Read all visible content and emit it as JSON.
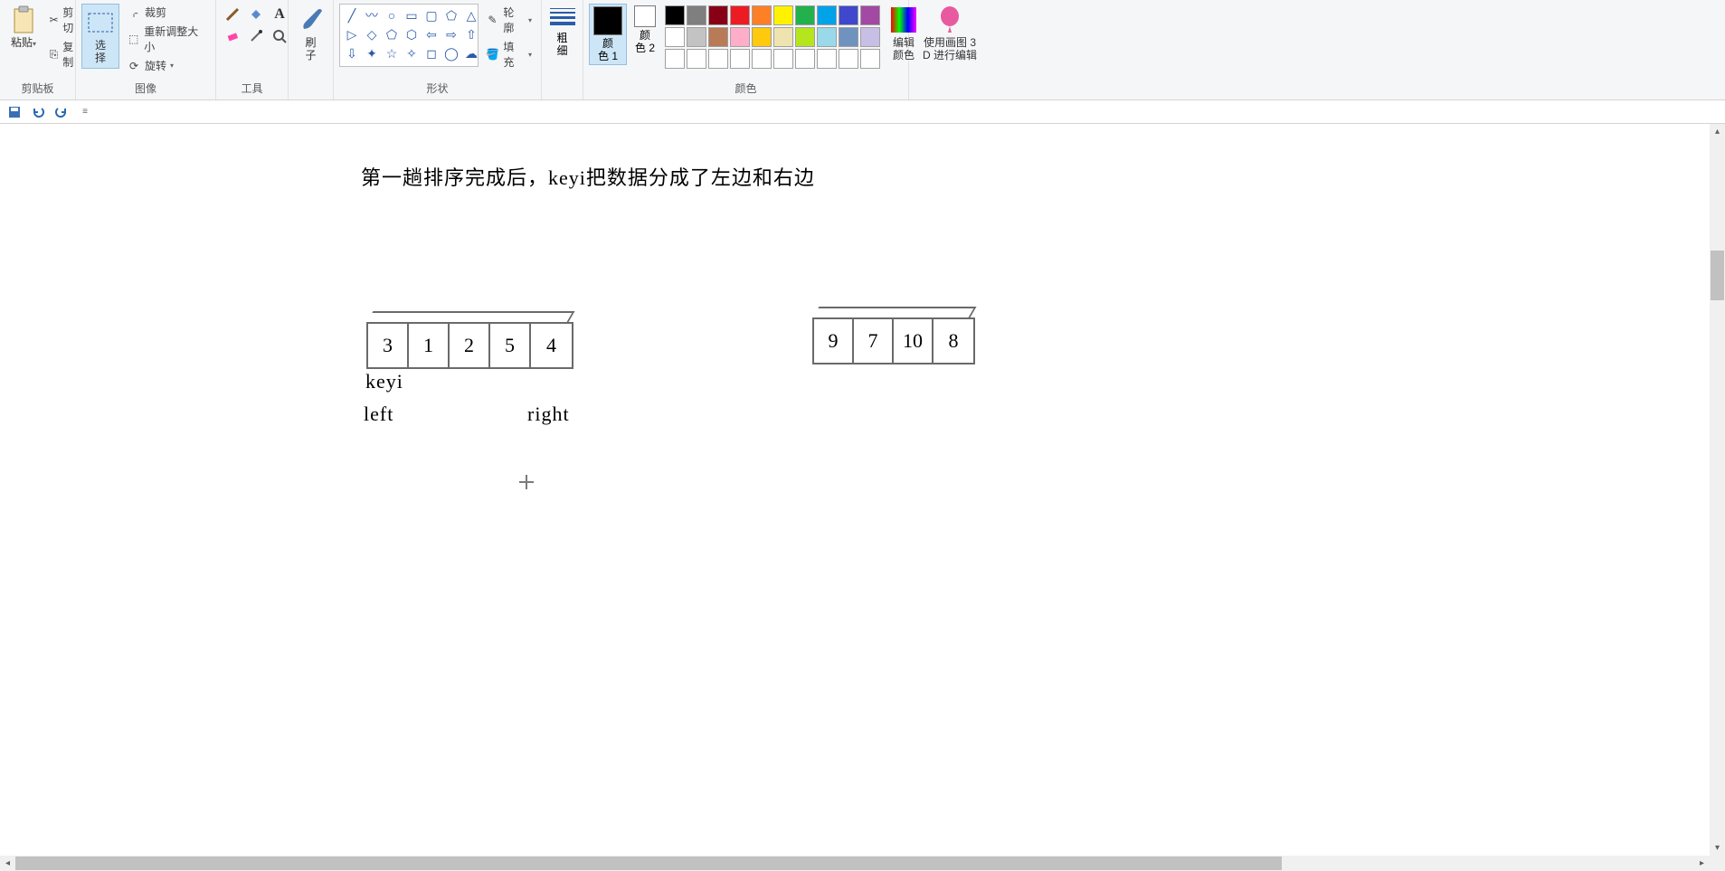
{
  "ribbon": {
    "clipboard": {
      "paste": "粘贴",
      "cut": "剪切",
      "copy": "复制",
      "group": "剪贴板"
    },
    "image": {
      "select": "选\n择",
      "crop": "裁剪",
      "resize": "重新调整大小",
      "rotate": "旋转",
      "group": "图像"
    },
    "tools": {
      "group": "工具"
    },
    "brush": {
      "label": "刷\n子"
    },
    "shapes": {
      "outline": "轮廓",
      "fill": "填充",
      "group": "形状"
    },
    "stroke": {
      "label": "粗\n细"
    },
    "colors": {
      "color1": "颜\n色 1",
      "color2": "颜\n色 2",
      "edit": "编辑\n颜色",
      "group": "颜色",
      "palette_row1": [
        "#000000",
        "#7f7f7f",
        "#880015",
        "#ed1c24",
        "#ff7f27",
        "#fff200",
        "#22b14c",
        "#00a2e8",
        "#3f48cc",
        "#a349a4"
      ],
      "palette_row2": [
        "#ffffff",
        "#c3c3c3",
        "#b97a57",
        "#ffaec9",
        "#ffc90e",
        "#efe4b0",
        "#b5e61d",
        "#99d9ea",
        "#7092be",
        "#c8bfe7"
      ],
      "palette_row3": [
        "#ffffff",
        "#ffffff",
        "#ffffff",
        "#ffffff",
        "#ffffff",
        "#ffffff",
        "#ffffff",
        "#ffffff",
        "#ffffff",
        "#ffffff"
      ]
    },
    "paint3d": "使用画图 3\nD 进行编辑"
  },
  "canvas": {
    "title_text": "第一趟排序完成后，keyi把数据分成了左边和右边",
    "left_array": [
      "3",
      "1",
      "2",
      "5",
      "4"
    ],
    "right_array": [
      "9",
      "7",
      "10",
      "8"
    ],
    "label_keyi": "keyi",
    "label_left": "left",
    "label_right": "right"
  }
}
